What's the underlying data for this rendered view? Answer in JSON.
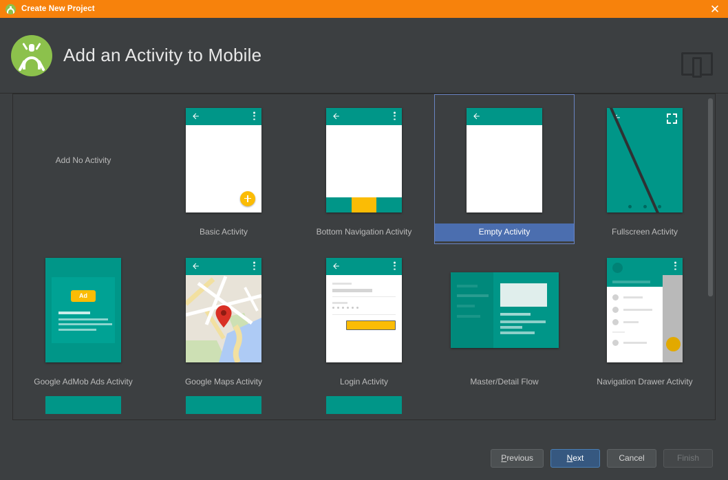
{
  "window": {
    "title": "Create New Project",
    "icon": "android-studio-icon",
    "close_label": "✕"
  },
  "header": {
    "title": "Add an Activity to Mobile",
    "logo_icon": "android-studio-logo",
    "form_factor_icon": "mobile-device-icon"
  },
  "gallery": {
    "items": [
      {
        "id": "add-no-activity",
        "label": "Add No Activity",
        "thumb": "none",
        "selected": false
      },
      {
        "id": "basic-activity",
        "label": "Basic Activity",
        "thumb": "basic",
        "selected": false
      },
      {
        "id": "bottom-navigation",
        "label": "Bottom Navigation Activity",
        "thumb": "bottomnav",
        "selected": false
      },
      {
        "id": "empty-activity",
        "label": "Empty Activity",
        "thumb": "empty",
        "selected": true
      },
      {
        "id": "fullscreen-activity",
        "label": "Fullscreen Activity",
        "thumb": "fullscreen",
        "selected": false
      },
      {
        "id": "google-admob-ads",
        "label": "Google AdMob Ads Activity",
        "thumb": "admob",
        "selected": false
      },
      {
        "id": "google-maps",
        "label": "Google Maps Activity",
        "thumb": "maps",
        "selected": false
      },
      {
        "id": "login-activity",
        "label": "Login Activity",
        "thumb": "login",
        "selected": false
      },
      {
        "id": "master-detail-flow",
        "label": "Master/Detail Flow",
        "thumb": "masterdetail",
        "selected": false
      },
      {
        "id": "navigation-drawer",
        "label": "Navigation Drawer Activity",
        "thumb": "navdrawer",
        "selected": false
      }
    ],
    "ad_badge_text": "Ad",
    "scroll_position": "top"
  },
  "footer": {
    "previous_label": "Previous",
    "previous_mnemonic": "P",
    "next_label": "Next",
    "next_mnemonic": "N",
    "cancel_label": "Cancel",
    "finish_label": "Finish",
    "finish_enabled": false
  },
  "colors": {
    "titlebar": "#f7820c",
    "dialog_bg": "#3c3f41",
    "selection_blue": "#4b6eaf",
    "primary_button": "#365880",
    "teal": "#009688",
    "amber": "#fbbc05",
    "android_green": "#8cc14c"
  }
}
